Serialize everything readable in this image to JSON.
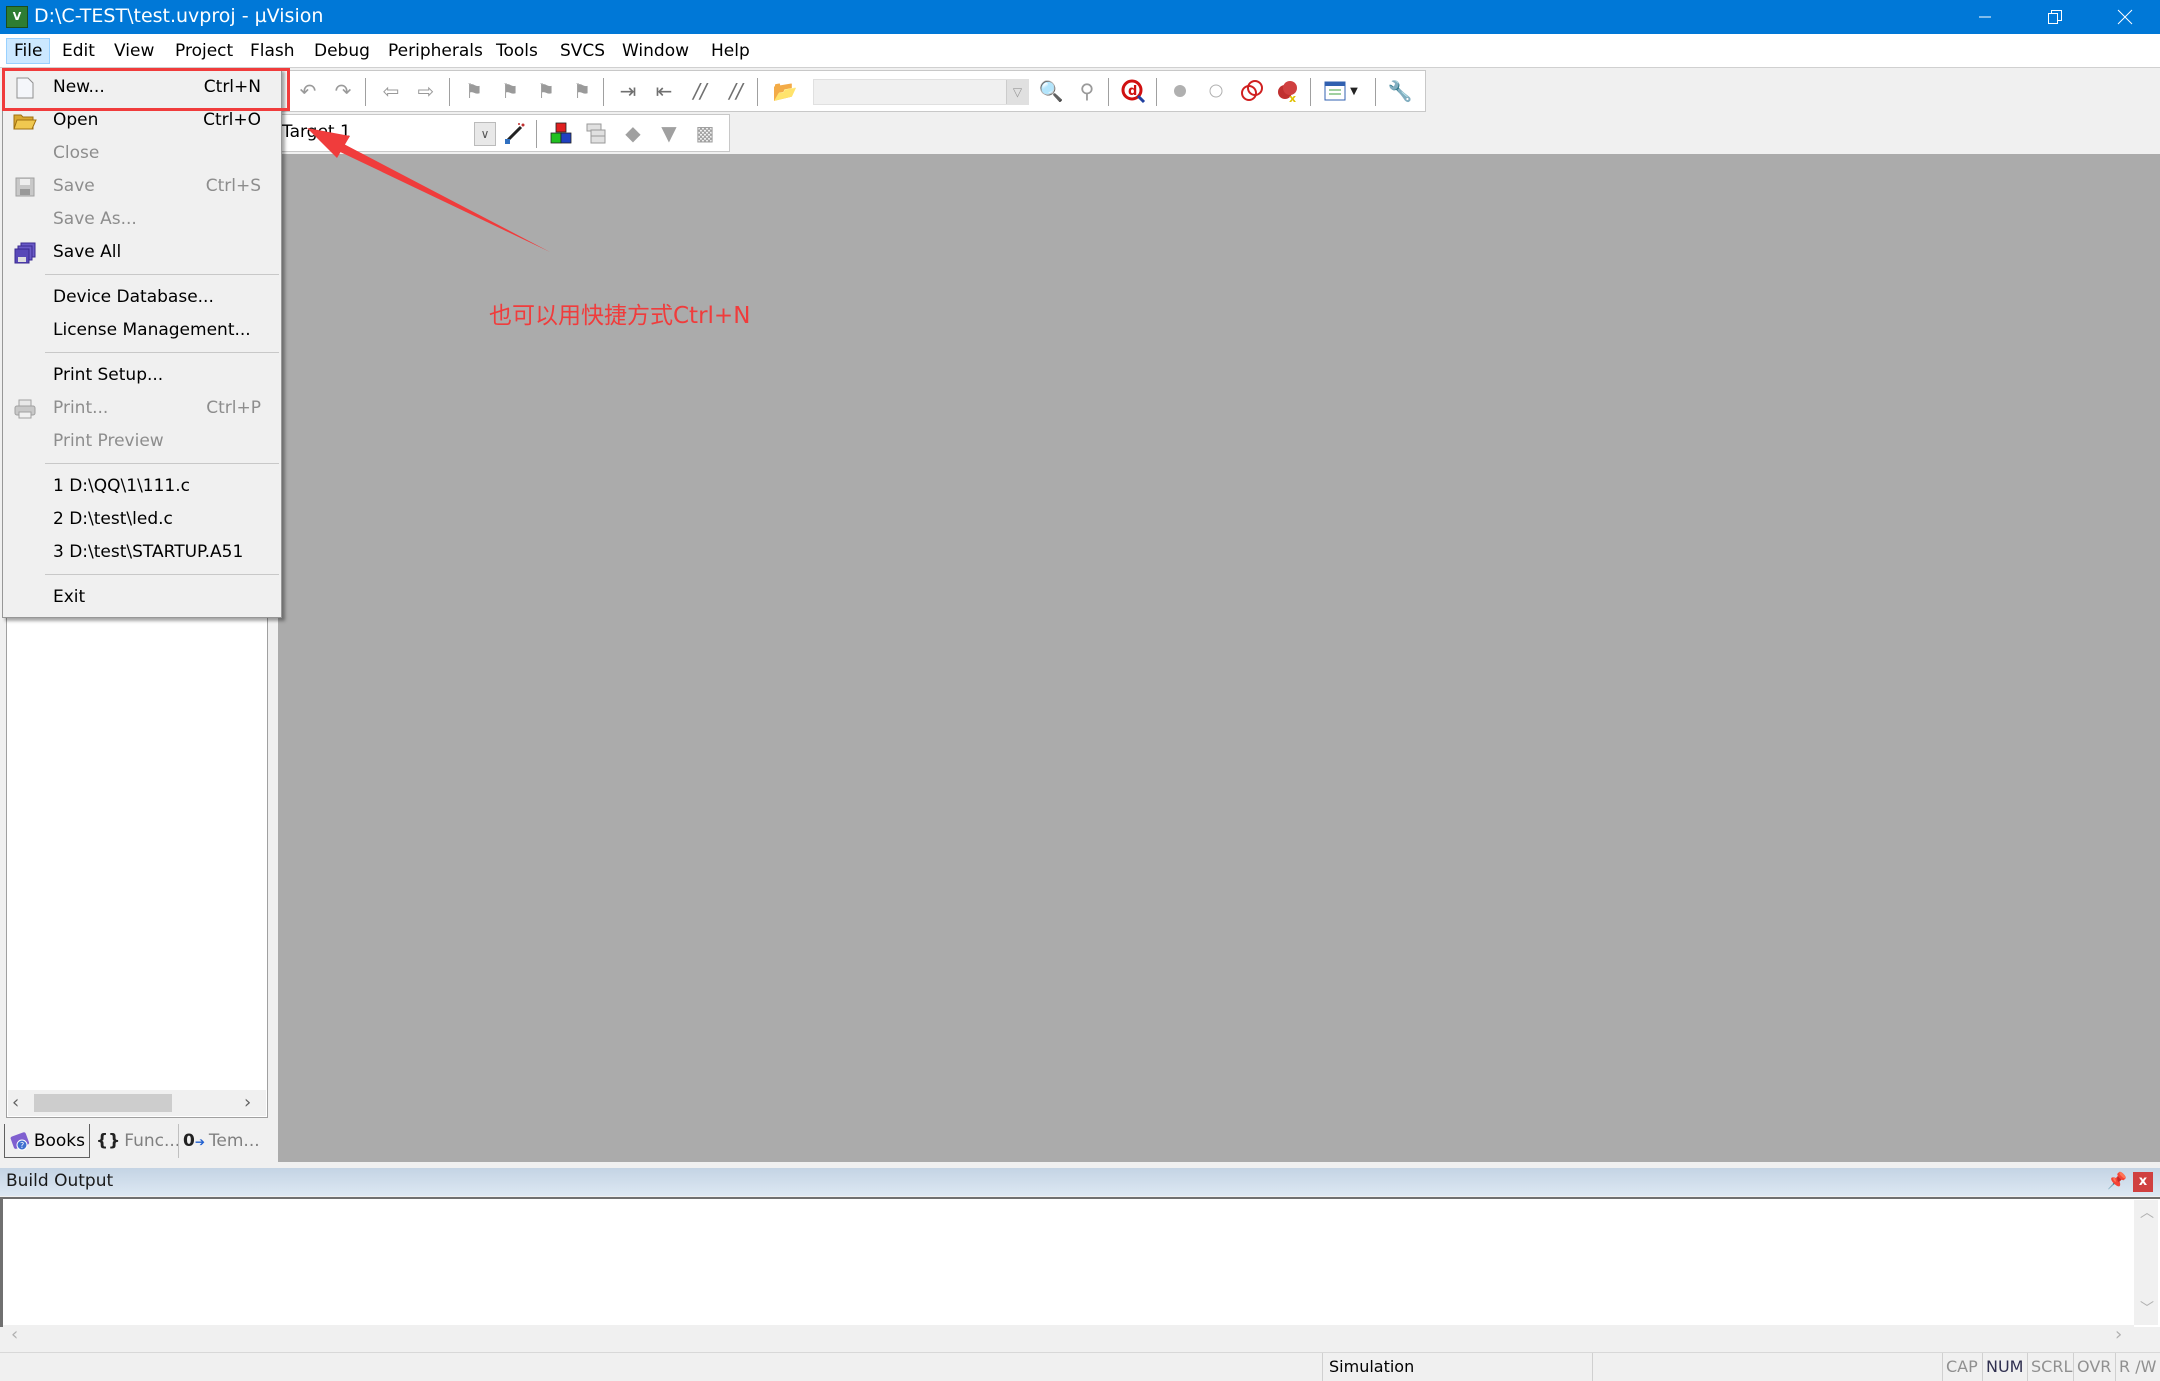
{
  "window": {
    "title": "D:\\C-TEST\\test.uvproj - µVision",
    "app_icon": "uvision-icon",
    "controls": {
      "minimize": "minimize-icon",
      "restore": "restore-icon",
      "close": "close-icon"
    }
  },
  "menubar": {
    "items": [
      {
        "label": "File",
        "active": true
      },
      {
        "label": "Edit"
      },
      {
        "label": "View"
      },
      {
        "label": "Project"
      },
      {
        "label": "Flash"
      },
      {
        "label": "Debug"
      },
      {
        "label": "Peripherals"
      },
      {
        "label": "Tools"
      },
      {
        "label": "SVCS"
      },
      {
        "label": "Window"
      },
      {
        "label": "Help"
      }
    ]
  },
  "toolbar1": {
    "icons": [
      "undo-icon",
      "redo-icon",
      "navigate-back-icon",
      "navigate-forward-icon",
      "bookmark-insert-icon",
      "bookmark-previous-icon",
      "bookmark-next-icon",
      "bookmark-clear-icon",
      "indent-icon",
      "unindent-icon",
      "comment-icon",
      "uncomment-icon",
      "find-in-files-icon",
      "find-icon",
      "incremental-find-icon",
      "debug-session-icon",
      "insert-breakpoint-icon",
      "enable-breakpoint-icon",
      "disable-breakpoints-icon",
      "kill-breakpoints-icon",
      "window-layout-icon",
      "configure-icon"
    ],
    "find_combo_value": ""
  },
  "toolbar2": {
    "target": "Target 1",
    "icons": [
      "target-options-wizard-icon",
      "manage-components-icon",
      "file-extensions-icon",
      "pack-installer-icon",
      "select-packs-icon",
      "manage-packs-icon"
    ]
  },
  "file_menu": {
    "items": [
      {
        "label": "New...",
        "shortcut": "Ctrl+N",
        "icon": "new-file-icon",
        "enabled": true
      },
      {
        "label": "Open",
        "shortcut": "Ctrl+O",
        "icon": "open-folder-icon",
        "enabled": true
      },
      {
        "label": "Close",
        "shortcut": "",
        "enabled": false
      },
      {
        "label": "Save",
        "shortcut": "Ctrl+S",
        "icon": "save-icon",
        "enabled": false
      },
      {
        "label": "Save As...",
        "shortcut": "",
        "enabled": false
      },
      {
        "label": "Save All",
        "shortcut": "",
        "icon": "save-all-icon",
        "enabled": true
      },
      {
        "label": "Device Database...",
        "shortcut": "",
        "enabled": true
      },
      {
        "label": "License Management...",
        "shortcut": "",
        "enabled": true
      },
      {
        "label": "Print Setup...",
        "shortcut": "",
        "enabled": true
      },
      {
        "label": "Print...",
        "shortcut": "Ctrl+P",
        "icon": "print-icon",
        "enabled": false
      },
      {
        "label": "Print Preview",
        "shortcut": "",
        "enabled": false
      },
      {
        "label": "1 D:\\QQ\\1\\111.c",
        "shortcut": "",
        "enabled": true
      },
      {
        "label": "2 D:\\test\\led.c",
        "shortcut": "",
        "enabled": true
      },
      {
        "label": "3 D:\\test\\STARTUP.A51",
        "shortcut": "",
        "enabled": true
      },
      {
        "label": "Exit",
        "shortcut": "",
        "enabled": true
      }
    ]
  },
  "project_panel": {
    "tabs": [
      {
        "label": "Books",
        "icon": "books-icon",
        "active": true
      },
      {
        "label": "Func...",
        "icon": "functions-icon",
        "active": false
      },
      {
        "label": "Tem...",
        "icon": "templates-icon",
        "active": false
      }
    ]
  },
  "build_output": {
    "title": "Build Output",
    "content": ""
  },
  "statusbar": {
    "mode": "Simulation",
    "indicators": [
      {
        "label": "CAP",
        "on": false
      },
      {
        "label": "NUM",
        "on": true
      },
      {
        "label": "SCRL",
        "on": false
      },
      {
        "label": "OVR",
        "on": false
      },
      {
        "label": "R /W",
        "on": false
      }
    ]
  },
  "annotation": {
    "text": "也可以用快捷方式Ctrl+N",
    "color": "#f03c3c"
  },
  "colors": {
    "titlebar": "#0078d7",
    "editor_background": "#ababab",
    "annotation": "#f03c3c"
  }
}
